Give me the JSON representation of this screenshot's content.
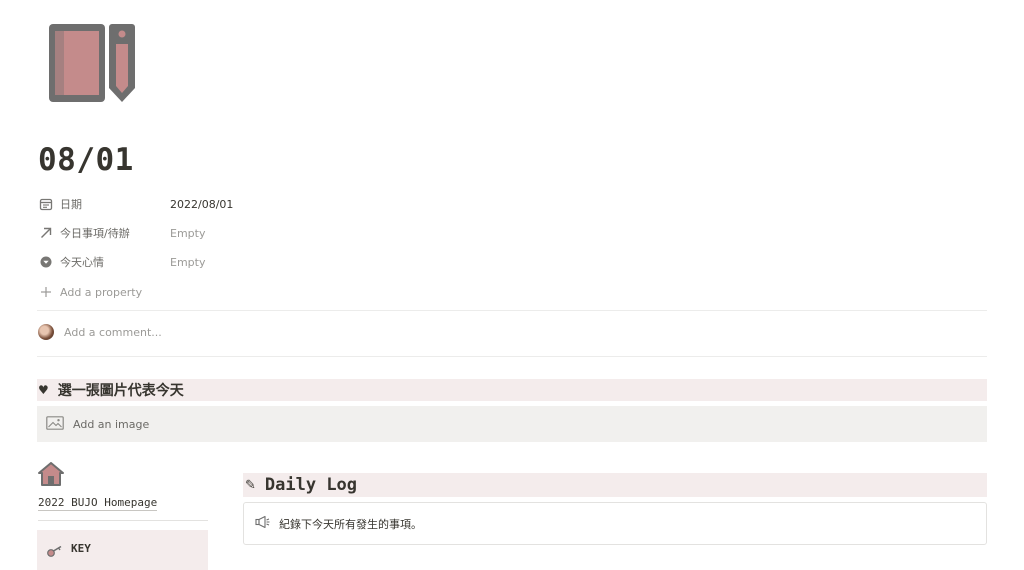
{
  "page": {
    "icon": "notebook-pencil-icon",
    "title": "08/01"
  },
  "properties": [
    {
      "icon": "calendar-icon",
      "name": "日期",
      "value": "2022/08/01",
      "empty": false
    },
    {
      "icon": "relation-arrow-icon",
      "name": "今日事項/待辦",
      "value": "Empty",
      "empty": true
    },
    {
      "icon": "select-dropdown-icon",
      "name": "今天心情",
      "value": "Empty",
      "empty": true
    }
  ],
  "add_property": {
    "icon": "plus-icon",
    "label": "Add a property"
  },
  "comment": {
    "placeholder": "Add a comment..."
  },
  "image_section": {
    "heading": "選一張圖片代表今天",
    "heading_icon": "♥",
    "add_image_label": "Add an image"
  },
  "sidebar": {
    "home_icon": "house-icon",
    "home_link": "2022 BUJO Homepage",
    "key_label": "KEY",
    "key_icon": "key-icon"
  },
  "daily_log": {
    "heading_icon": "✎",
    "heading": "Daily Log",
    "callout_icon": "megaphone-icon",
    "callout_text": "紀錄下今天所有發生的事項。"
  },
  "colors": {
    "accent_pink": "#c48b8b",
    "icon_gray": "#6f6f6f",
    "heading_bg": "#f4ecec",
    "image_block_bg": "#f1f0ee"
  }
}
